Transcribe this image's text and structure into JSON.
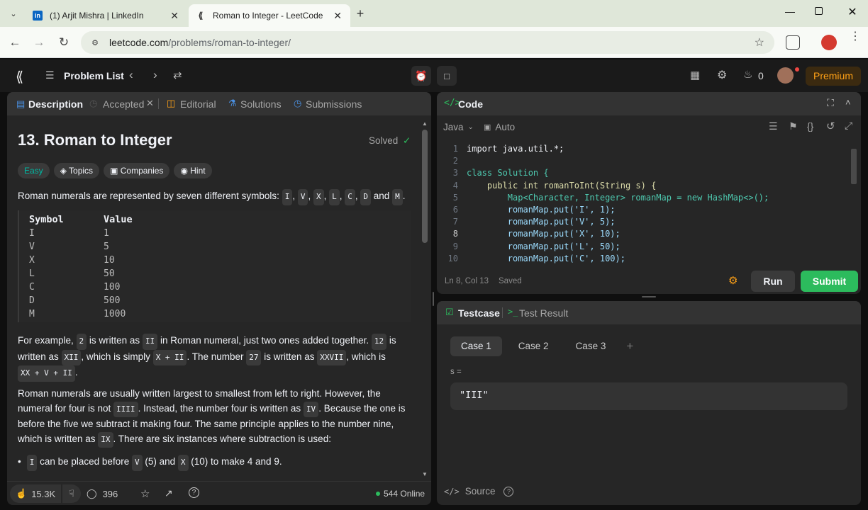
{
  "browser": {
    "tabs": [
      {
        "title": "(1) Arjit Mishra | LinkedIn",
        "icon": "linkedin-icon",
        "active": false
      },
      {
        "title": "Roman to Integer - LeetCode",
        "icon": "leetcode-icon",
        "active": true
      }
    ],
    "url_host": "leetcode.com",
    "url_path": "/problems/roman-to-integer/"
  },
  "nav": {
    "problem_list": "Problem List",
    "streak": "0",
    "premium": "Premium"
  },
  "left_tabs": {
    "description": "Description",
    "accepted": "Accepted",
    "editorial": "Editorial",
    "solutions": "Solutions",
    "submissions": "Submissions"
  },
  "problem": {
    "title": "13. Roman to Integer",
    "status": "Solved",
    "difficulty": "Easy",
    "topics": "Topics",
    "companies": "Companies",
    "hint": "Hint",
    "intro": {
      "pre": "Roman numerals are represented by seven different symbols: ",
      "symbols": [
        "I",
        "V",
        "X",
        "L",
        "C",
        "D",
        "M"
      ],
      "and": "and",
      "end": "."
    },
    "table_header": [
      "Symbol",
      "Value"
    ],
    "table_rows": [
      [
        "I",
        "1"
      ],
      [
        "V",
        "5"
      ],
      [
        "X",
        "10"
      ],
      [
        "L",
        "50"
      ],
      [
        "C",
        "100"
      ],
      [
        "D",
        "500"
      ],
      [
        "M",
        "1000"
      ]
    ],
    "para2": {
      "t1": "For example, ",
      "c1": "2",
      "t2": " is written as ",
      "c2": "II",
      "t3": " in Roman numeral, just two ones added together. ",
      "c3": "12",
      "t4": " is written as ",
      "c4": "XII",
      "t5": ", which is simply ",
      "c5": "X + II",
      "t6": ". The number ",
      "c6": "27",
      "t7": " is written as ",
      "c7": "XXVII",
      "t8": ", which is ",
      "c8": "XX + V + II",
      "t9": "."
    },
    "para3": {
      "t1": "Roman numerals are usually written largest to smallest from left to right. However, the numeral for four is not ",
      "c1": "IIII",
      "t2": ". Instead, the number four is written as ",
      "c2": "IV",
      "t3": ". Because the one is before the five we subtract it making four. The same principle applies to the number nine, which is written as ",
      "c3": "IX",
      "t4": ". There are six instances where subtraction is used:"
    },
    "bullet1": {
      "c1": "I",
      "t1": " can be placed before ",
      "c2": "V",
      "t2": " (5) and ",
      "c3": "X",
      "t3": " (10) to make 4 and 9."
    }
  },
  "footer": {
    "likes": "15.3K",
    "comments": "396",
    "online": "544 Online"
  },
  "code_panel": {
    "title": "Code",
    "language": "Java",
    "mode": "Auto",
    "status_pos": "Ln 8, Col 13",
    "status_saved": "Saved",
    "run": "Run",
    "submit": "Submit",
    "lines": [
      {
        "n": "1",
        "text": "import java.util.*;"
      },
      {
        "n": "2",
        "text": ""
      },
      {
        "n": "3",
        "text": "class Solution {"
      },
      {
        "n": "4",
        "text": "    public int romanToInt(String s) {"
      },
      {
        "n": "5",
        "text": "        Map<Character, Integer> romanMap = new HashMap<>();"
      },
      {
        "n": "6",
        "text": "        romanMap.put('I', 1);"
      },
      {
        "n": "7",
        "text": "        romanMap.put('V', 5);"
      },
      {
        "n": "8",
        "text": "        romanMap.put('X', 10);"
      },
      {
        "n": "9",
        "text": "        romanMap.put('L', 50);"
      },
      {
        "n": "10",
        "text": "        romanMap.put('C', 100);"
      }
    ]
  },
  "test_panel": {
    "testcase": "Testcase",
    "test_result": "Test Result",
    "cases": [
      "Case 1",
      "Case 2",
      "Case 3"
    ],
    "var_label": "s =",
    "var_value": "\"III\"",
    "source": "Source"
  },
  "colors": {
    "accent_green": "#2cbb5d",
    "premium_orange": "#ffa116",
    "easy": "#00b8a3"
  }
}
